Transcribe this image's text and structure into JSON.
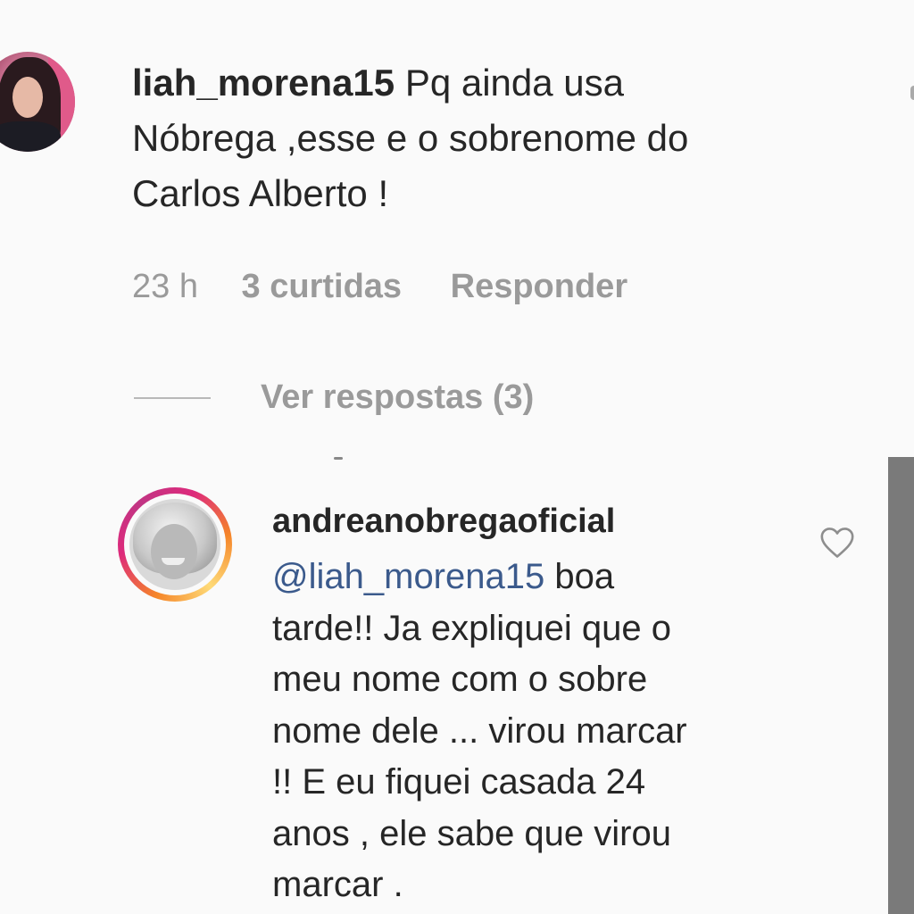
{
  "comment_1": {
    "username": "liah_morena15",
    "text_line1": "Pq ainda usa",
    "text_line2": "Nóbrega ,esse e o sobrenome do",
    "text_line3": "Carlos Alberto !",
    "time": "23 h",
    "likes": "3 curtidas",
    "reply_label": "Responder",
    "view_replies_label": "Ver respostas (3)"
  },
  "comment_2": {
    "username": "andreanobregaoficial",
    "mention": "@liah_morena15",
    "text_line1_rest": " boa",
    "text_line2": "tarde!! Ja expliquei que o",
    "text_line3": "meu nome com o sobre",
    "text_line4": "nome dele ... virou marcar",
    "text_line5": "!! E eu fiquei casada 24",
    "text_line6": "anos , ele sabe que virou",
    "text_line7": "marcar ."
  },
  "icons": {
    "like": "heart-outline-icon"
  },
  "colors": {
    "mention": "#3b5a8c",
    "meta_text": "#9a9a9a",
    "story_ring_start": "#f58529",
    "story_ring_end": "#c13584"
  }
}
